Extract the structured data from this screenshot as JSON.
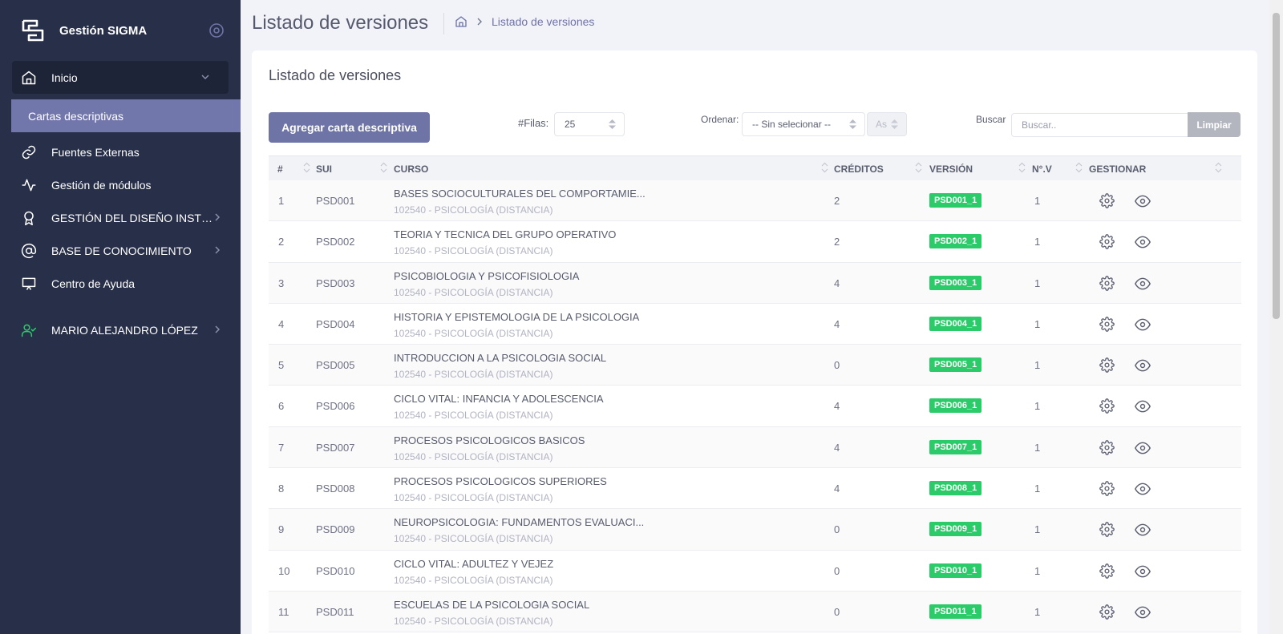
{
  "brand": {
    "name": "Gestión SIGMA"
  },
  "sidebar": {
    "items": [
      {
        "label": "Inicio",
        "icon": "home-icon"
      },
      {
        "label": "Cartas descriptivas"
      },
      {
        "label": "Fuentes Externas",
        "icon": "link-icon"
      },
      {
        "label": "Gestión de módulos",
        "icon": "activity-icon"
      },
      {
        "label": "GESTIÓN DEL DISEÑO INSTRUC...",
        "icon": "award-icon"
      },
      {
        "label": "BASE DE CONOCIMIENTO",
        "icon": "at-icon"
      },
      {
        "label": "Centro de Ayuda",
        "icon": "monitor-icon"
      }
    ],
    "user": {
      "label": "MARIO ALEJANDRO LÓPEZ",
      "icon": "user-check-icon"
    }
  },
  "header": {
    "title": "Listado de versiones",
    "breadcrumb": {
      "current": "Listado de versiones"
    }
  },
  "card": {
    "title": "Listado de versiones",
    "add_button": "Agregar carta descriptiva",
    "rows_label": "#Filas:",
    "rows_value": "25",
    "order_label": "Ordenar:",
    "order_value": "-- Sin selecionar --",
    "order_dir": "As",
    "search_label": "Buscar",
    "search_placeholder": "Buscar..",
    "clear_button": "Limpiar"
  },
  "table": {
    "columns": [
      "#",
      "SUI",
      "CURSO",
      "CRÉDITOS",
      "VERSIÓN",
      "N°.V",
      "GESTIONAR"
    ],
    "rows": [
      {
        "num": "1",
        "sui": "PSD001",
        "curso": "BASES SOCIOCULTURALES DEL COMPORTAMIE...",
        "programa": "102540 - PSICOLOGÍA (DISTANCIA)",
        "creditos": "2",
        "version": "PSD001_1",
        "nv": "1"
      },
      {
        "num": "2",
        "sui": "PSD002",
        "curso": "TEORIA Y TECNICA DEL GRUPO OPERATIVO",
        "programa": "102540 - PSICOLOGÍA (DISTANCIA)",
        "creditos": "2",
        "version": "PSD002_1",
        "nv": "1"
      },
      {
        "num": "3",
        "sui": "PSD003",
        "curso": "PSICOBIOLOGIA Y PSICOFISIOLOGIA",
        "programa": "102540 - PSICOLOGÍA (DISTANCIA)",
        "creditos": "4",
        "version": "PSD003_1",
        "nv": "1"
      },
      {
        "num": "4",
        "sui": "PSD004",
        "curso": "HISTORIA Y EPISTEMOLOGIA DE LA PSICOLOGIA",
        "programa": "102540 - PSICOLOGÍA (DISTANCIA)",
        "creditos": "4",
        "version": "PSD004_1",
        "nv": "1"
      },
      {
        "num": "5",
        "sui": "PSD005",
        "curso": "INTRODUCCION A LA PSICOLOGIA SOCIAL",
        "programa": "102540 - PSICOLOGÍA (DISTANCIA)",
        "creditos": "0",
        "version": "PSD005_1",
        "nv": "1"
      },
      {
        "num": "6",
        "sui": "PSD006",
        "curso": "CICLO VITAL: INFANCIA Y ADOLESCENCIA",
        "programa": "102540 - PSICOLOGÍA (DISTANCIA)",
        "creditos": "4",
        "version": "PSD006_1",
        "nv": "1"
      },
      {
        "num": "7",
        "sui": "PSD007",
        "curso": "PROCESOS PSICOLOGICOS BASICOS",
        "programa": "102540 - PSICOLOGÍA (DISTANCIA)",
        "creditos": "4",
        "version": "PSD007_1",
        "nv": "1"
      },
      {
        "num": "8",
        "sui": "PSD008",
        "curso": "PROCESOS PSICOLOGICOS SUPERIORES",
        "programa": "102540 - PSICOLOGÍA (DISTANCIA)",
        "creditos": "4",
        "version": "PSD008_1",
        "nv": "1"
      },
      {
        "num": "9",
        "sui": "PSD009",
        "curso": "NEUROPSICOLOGIA: FUNDAMENTOS EVALUACI...",
        "programa": "102540 - PSICOLOGÍA (DISTANCIA)",
        "creditos": "0",
        "version": "PSD009_1",
        "nv": "1"
      },
      {
        "num": "10",
        "sui": "PSD010",
        "curso": "CICLO VITAL: ADULTEZ Y VEJEZ",
        "programa": "102540 - PSICOLOGÍA (DISTANCIA)",
        "creditos": "0",
        "version": "PSD010_1",
        "nv": "1"
      },
      {
        "num": "11",
        "sui": "PSD011",
        "curso": "ESCUELAS DE LA PSICOLOGIA SOCIAL",
        "programa": "102540 - PSICOLOGÍA (DISTANCIA)",
        "creditos": "0",
        "version": "PSD011_1",
        "nv": "1"
      }
    ]
  },
  "colors": {
    "sidebar_bg": "#282f48",
    "accent": "#6e74a6",
    "version_badge": "#2ccb6a",
    "user_icon": "#2ccb6a"
  }
}
